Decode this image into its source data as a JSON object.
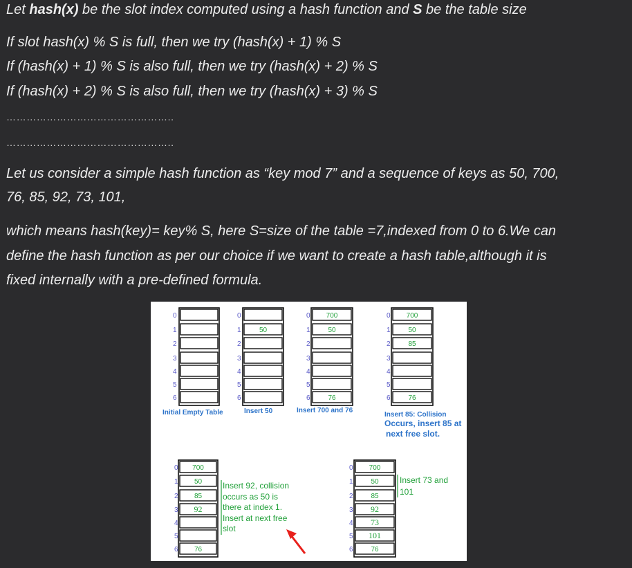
{
  "text": {
    "line1_pre": "Let ",
    "line1_b1": "hash(x)",
    "line1_mid": " be the slot index computed using a hash function and ",
    "line1_b2": "S",
    "line1_post": " be the table size",
    "line2": "If slot hash(x) % S is full, then we try (hash(x) + 1) % S",
    "line3": "If (hash(x) + 1) % S is also full, then we try (hash(x) + 2) % S",
    "line4": "If (hash(x) + 2) % S is also full, then we try (hash(x) + 3) % S",
    "dots1": "…………………………………………..",
    "dots2": "…………………………………………..",
    "para1_l1": "Let us consider a simple hash function as “key mod 7” and a sequence of keys as 50, 700,",
    "para1_l2": "76, 85, 92, 73, 101,",
    "para2_l1": "which means hash(key)= key% S, here S=size of the table =7,indexed from 0 to 6.We can",
    "para2_l2": "define the hash function as per our choice if we want to create a hash table,although it is",
    "para2_l3": "fixed internally with a pre-defined formula."
  },
  "figure": {
    "indices": [
      "0",
      "1",
      "2",
      "3",
      "4",
      "5",
      "6"
    ],
    "tables": [
      {
        "cells": [
          "",
          "",
          "",
          "",
          "",
          "",
          ""
        ],
        "caption": "Initial Empty Table"
      },
      {
        "cells": [
          "",
          "50",
          "",
          "",
          "",
          "",
          ""
        ],
        "caption": "Insert 50"
      },
      {
        "cells": [
          "700",
          "50",
          "",
          "",
          "",
          "",
          "76"
        ],
        "caption": "Insert 700 and 76"
      },
      {
        "cells": [
          "700",
          "50",
          "85",
          "",
          "",
          "",
          "76"
        ],
        "caption_l1": "Insert 85: Collision",
        "caption_l2": "Occurs, insert 85 at",
        "caption_l3": "next free slot."
      },
      {
        "cells": [
          "700",
          "50",
          "85",
          "92",
          "",
          "",
          "76"
        ],
        "note_l1": "Insert 92, collision",
        "note_l2": "occurs as 50 is",
        "note_l3": "there at index 1.",
        "note_l4": "Insert at next free",
        "note_l5": "slot"
      },
      {
        "cells": [
          "700",
          "50",
          "85",
          "92",
          "73",
          "101",
          "76"
        ],
        "note_l1": "Insert 73 and",
        "note_l2": "101"
      }
    ],
    "colors": {
      "index": "#5b5bc8",
      "value": "#23a13b",
      "caption": "#2c73c9",
      "arrow": "#e8201b"
    }
  }
}
